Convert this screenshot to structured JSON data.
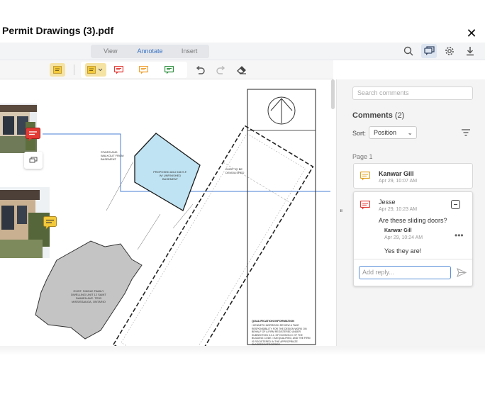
{
  "window": {
    "title": "Permit Drawings (3).pdf",
    "close_label": "✕"
  },
  "mode_tabs": [
    {
      "label": "View"
    },
    {
      "label": "Annotate"
    },
    {
      "label": "Insert"
    }
  ],
  "toolbar_icons": [
    "note-icon",
    "note-style-dropdown",
    "comment-red-icon",
    "comment-orange-icon",
    "comment-green-icon",
    "undo-icon",
    "redo-icon",
    "eraser-icon"
  ],
  "top_icons": [
    "search-icon",
    "comments-panel-icon",
    "settings-icon",
    "download-icon"
  ],
  "colors": {
    "accent": "#3b74c4",
    "note_yellow": "#f0c93a",
    "comment_red": "#e23b35",
    "comment_orange": "#f0a030",
    "comment_green": "#2e8f3e",
    "link_line": "#4a7fd4"
  },
  "panel": {
    "search_placeholder": "Search comments",
    "comments_title": "Comments",
    "comments_count": "(2)",
    "sort_label": "Sort:",
    "sort_value": "Position",
    "page_label": "Page 1",
    "threads": [
      {
        "author": "Kanwar Gill",
        "date": "Apr 29, 10:07 AM"
      },
      {
        "author": "Jesse",
        "date": "Apr 29, 10:23 AM",
        "text": "Are these sliding doors?",
        "reply": {
          "author": "Kanwar Gill",
          "date": "Apr 29, 10:24 AM",
          "text": "Yes they are!"
        }
      }
    ],
    "reply_placeholder": "Add reply..."
  },
  "drawing": {
    "label_stairs": "STAIRS AND WALKOUT FROM BASEMENT",
    "label_adu": "PROPOSED ADU 538 S.F. W/ UNFINISHED BASEMENT",
    "label_shed": "SHED TO BE DEMOLISHED",
    "label_existing": "EXIST. SINGLE FAMILY DWELLING UNIT 12 SAINT DAMIEN AVE. TR33 MISSISSAUGA, ONTARIO",
    "label_qual": "QUALIFICATION INFORMATION",
    "qual_text": "I KENNETH MORRISON REVIEW & TAKE RESPONSIBILITY FOR THE DESIGN WORK ON BEHALF OF A FIRM REGISTERED UNDER SUBSECTION 3.2.4. OF DIVISION C OF THE BUILDING CODE. I AM QUALIFIED, AND THE FIRM IS REGISTERED IN THE APPROPRIATE CLASSES/CATEGORIES"
  }
}
